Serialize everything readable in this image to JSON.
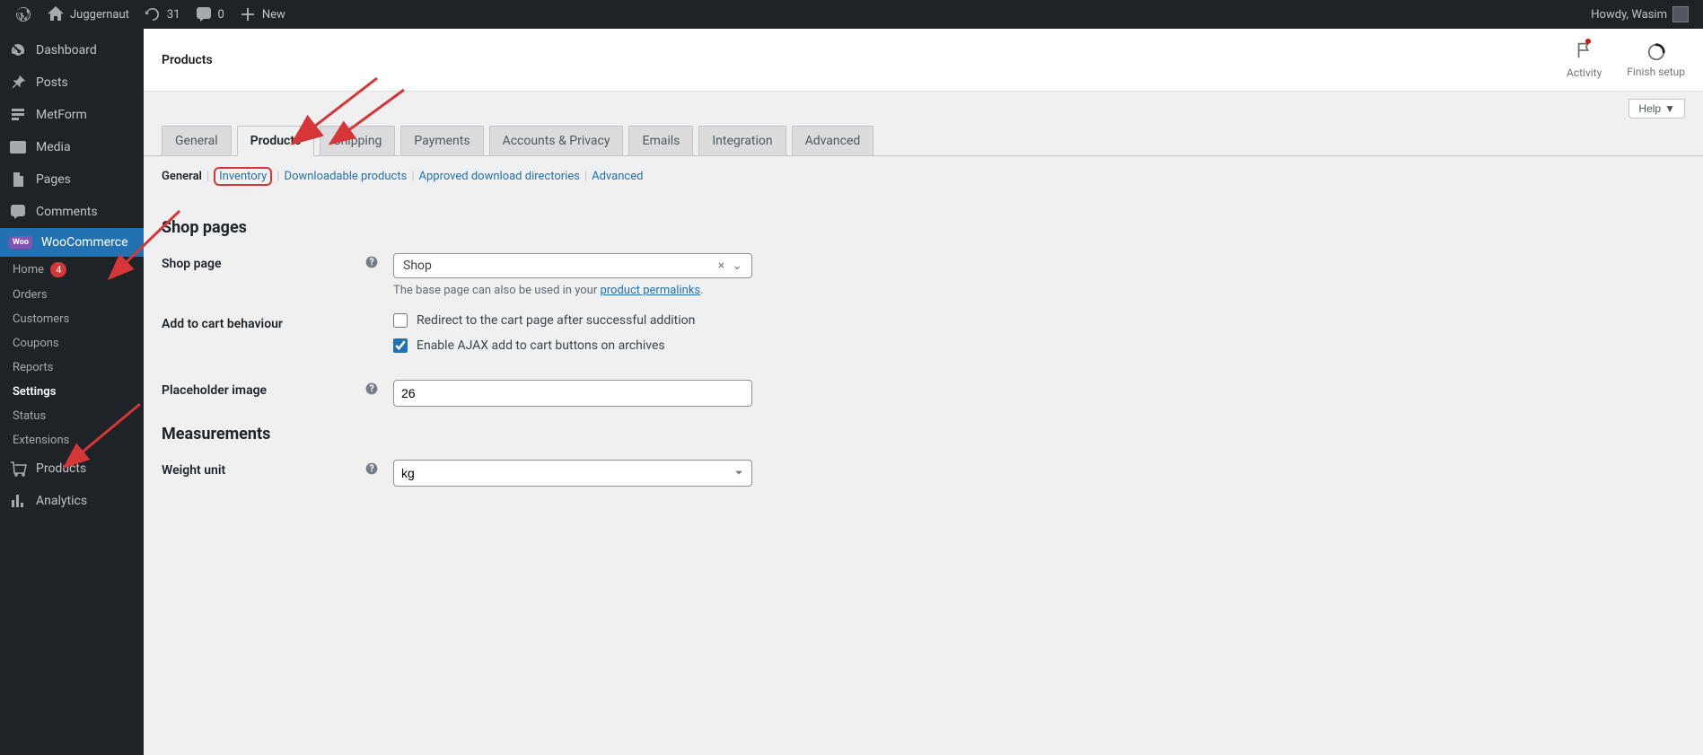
{
  "adminBar": {
    "siteName": "Juggernaut",
    "updatesCount": "31",
    "commentsCount": "0",
    "newLabel": "New",
    "howdy": "Howdy, Wasim"
  },
  "sidebar": {
    "dashboard": "Dashboard",
    "posts": "Posts",
    "metform": "MetForm",
    "media": "Media",
    "pages": "Pages",
    "comments": "Comments",
    "woocommerce": "WooCommerce",
    "products": "Products",
    "analytics": "Analytics"
  },
  "wooSubmenu": {
    "home": "Home",
    "homeBadge": "4",
    "orders": "Orders",
    "customers": "Customers",
    "coupons": "Coupons",
    "reports": "Reports",
    "settings": "Settings",
    "status": "Status",
    "extensions": "Extensions"
  },
  "header": {
    "pageTitle": "Products",
    "activity": "Activity",
    "finishSetup": "Finish setup"
  },
  "helpButton": "Help",
  "tabs": {
    "general": "General",
    "products": "Products",
    "shipping": "Shipping",
    "payments": "Payments",
    "accounts": "Accounts & Privacy",
    "emails": "Emails",
    "integration": "Integration",
    "advanced": "Advanced"
  },
  "subtabs": {
    "general": "General",
    "inventory": "Inventory",
    "downloadable": "Downloadable products",
    "approved": "Approved download directories",
    "advanced": "Advanced"
  },
  "sections": {
    "shopPages": "Shop pages",
    "measurements": "Measurements"
  },
  "fields": {
    "shopPage": {
      "label": "Shop page",
      "value": "Shop",
      "desc1": "The base page can also be used in your ",
      "descLink": "product permalinks",
      "desc2": "."
    },
    "addToCart": {
      "label": "Add to cart behaviour",
      "opt1": "Redirect to the cart page after successful addition",
      "opt2": "Enable AJAX add to cart buttons on archives"
    },
    "placeholder": {
      "label": "Placeholder image",
      "value": "26"
    },
    "weightUnit": {
      "label": "Weight unit",
      "value": "kg"
    }
  }
}
